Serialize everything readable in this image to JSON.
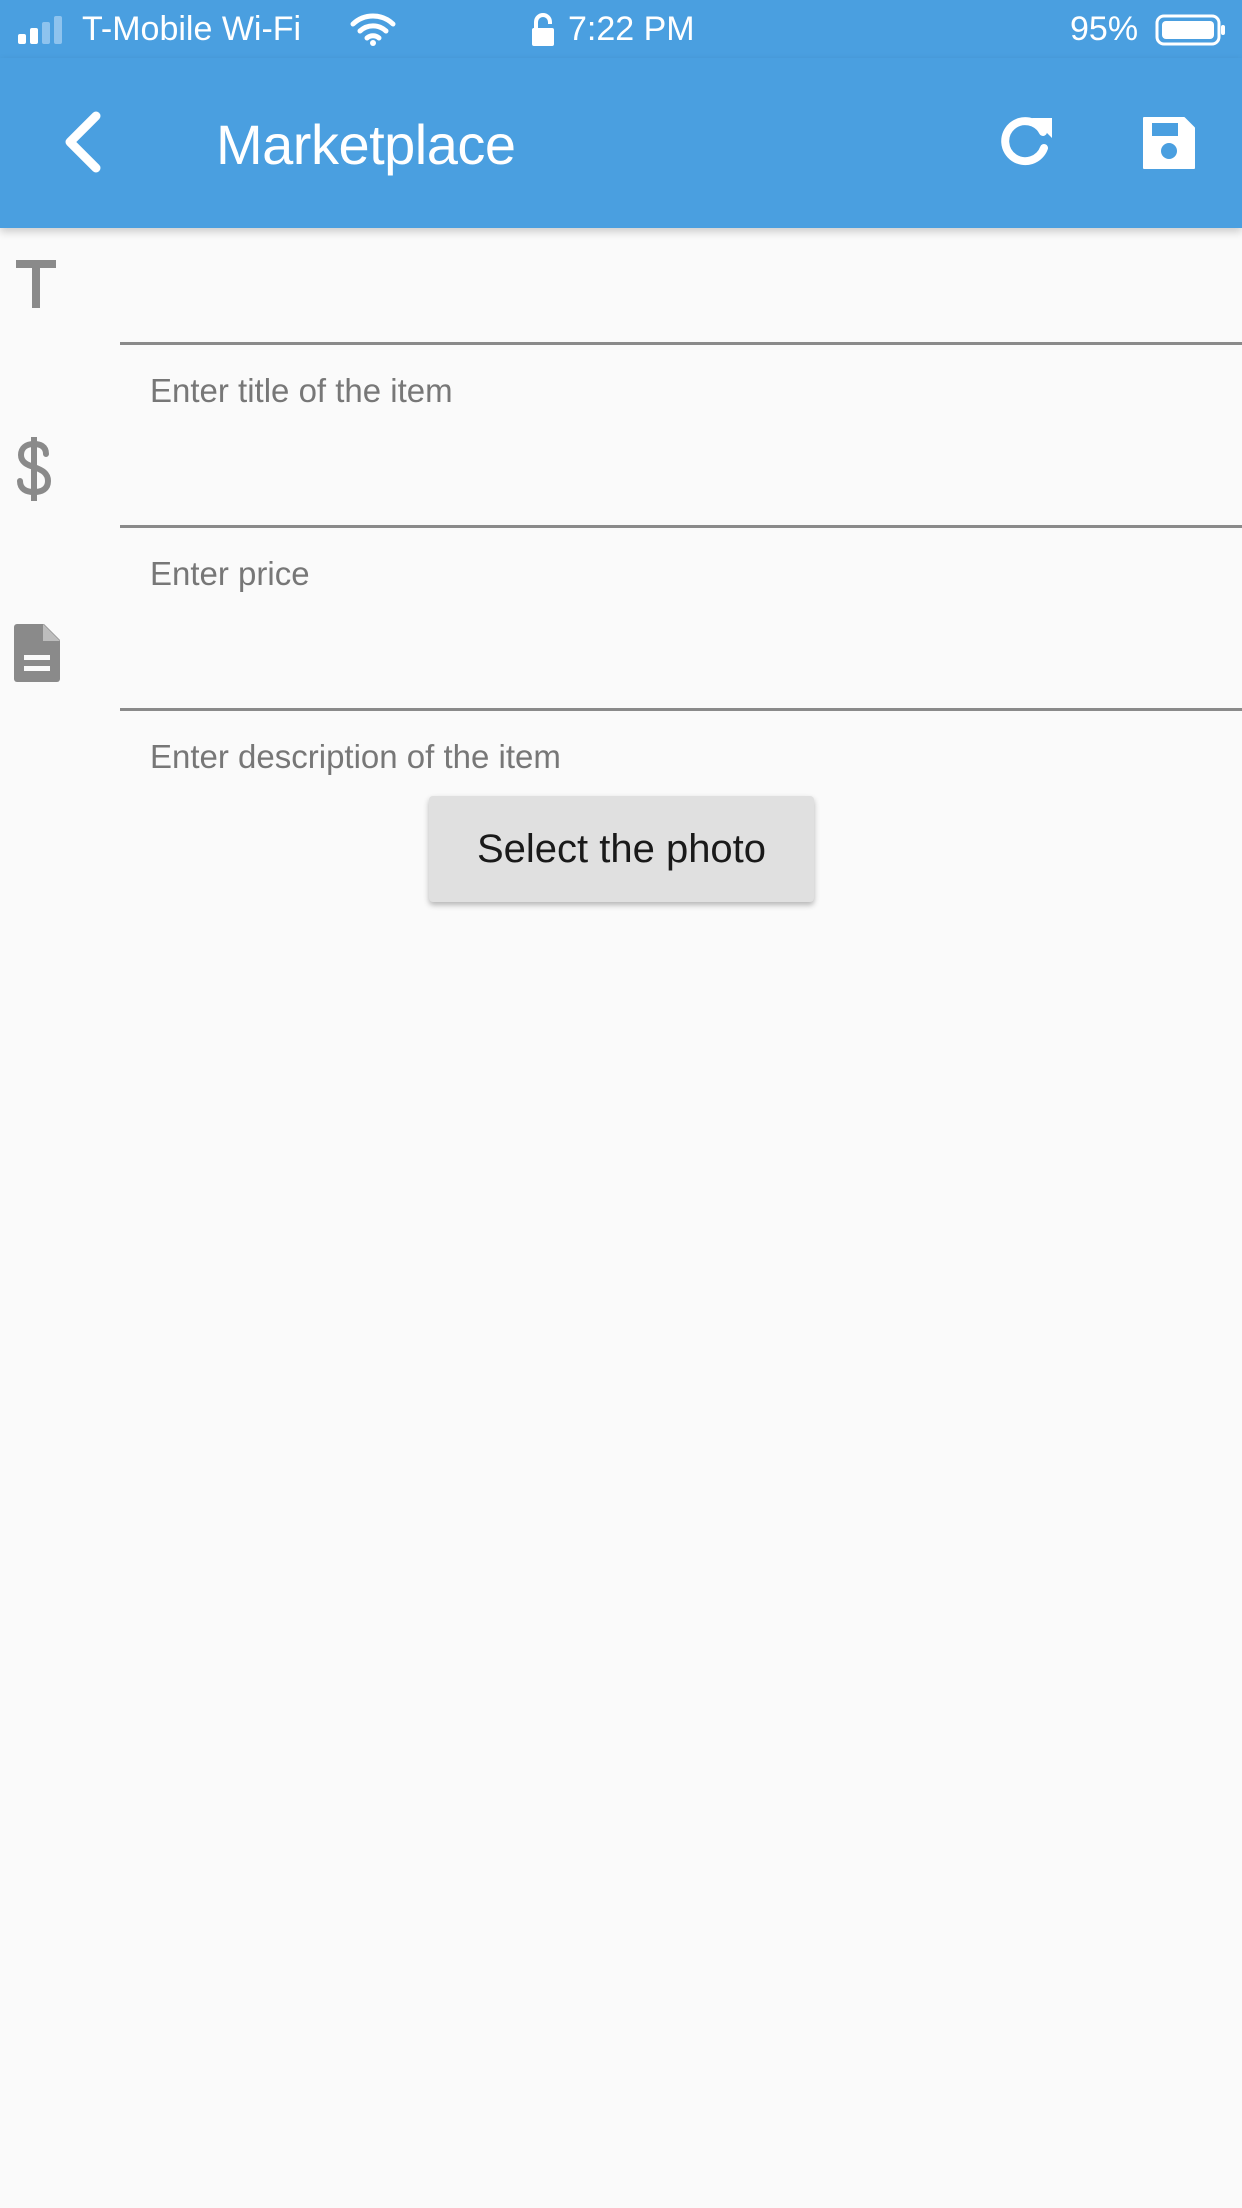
{
  "status_bar": {
    "carrier": "T-Mobile Wi-Fi",
    "time": "7:22 PM",
    "battery": "95%"
  },
  "app_bar": {
    "title": "Marketplace",
    "back_icon": "chevron-left-icon",
    "refresh_icon": "refresh-icon",
    "save_icon": "floppy-disk-icon"
  },
  "form": {
    "title_field": {
      "icon": "text-t-icon",
      "value": "",
      "hint": "Enter title of the item"
    },
    "price_field": {
      "icon": "dollar-icon",
      "value": "",
      "hint": "Enter price"
    },
    "description_field": {
      "icon": "document-icon",
      "value": "",
      "hint": "Enter description of the item"
    },
    "photo_button_label": "Select the photo"
  },
  "colors": {
    "primary": "#4a9fe0",
    "background": "#fafafa",
    "icon_gray": "#8a8a8a",
    "button_bg": "#e0e0e0"
  }
}
